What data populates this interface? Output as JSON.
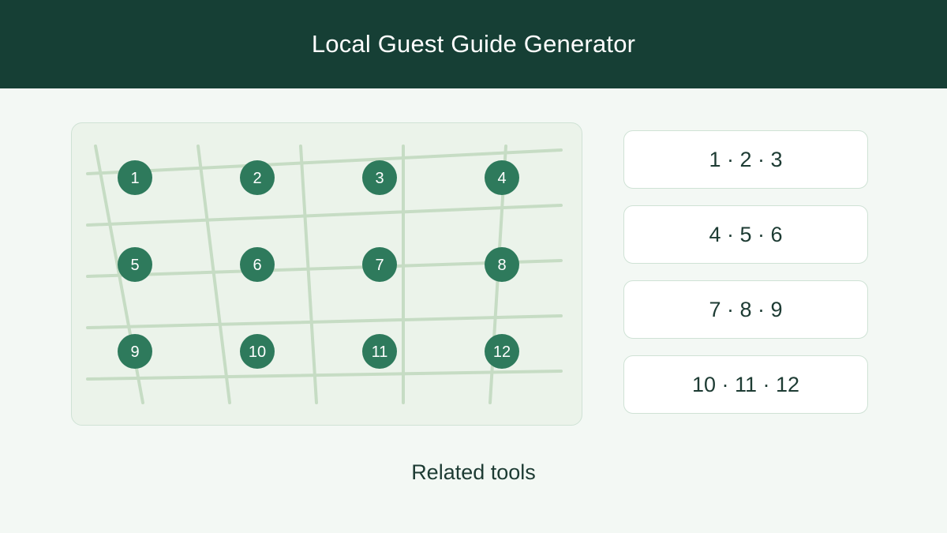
{
  "header": {
    "title": "Local Guest Guide Generator"
  },
  "map": {
    "pins": [
      "1",
      "2",
      "3",
      "4",
      "5",
      "6",
      "7",
      "8",
      "9",
      "10",
      "11",
      "12"
    ],
    "pin_color": "#2e7a5c",
    "street_color": "#c6dcc4"
  },
  "groups": [
    {
      "label": "1 · 2 · 3"
    },
    {
      "label": "4 · 5 · 6"
    },
    {
      "label": "7 · 8 · 9"
    },
    {
      "label": "10 · 11 · 12"
    }
  ],
  "footer": {
    "related_label": "Related tools"
  }
}
